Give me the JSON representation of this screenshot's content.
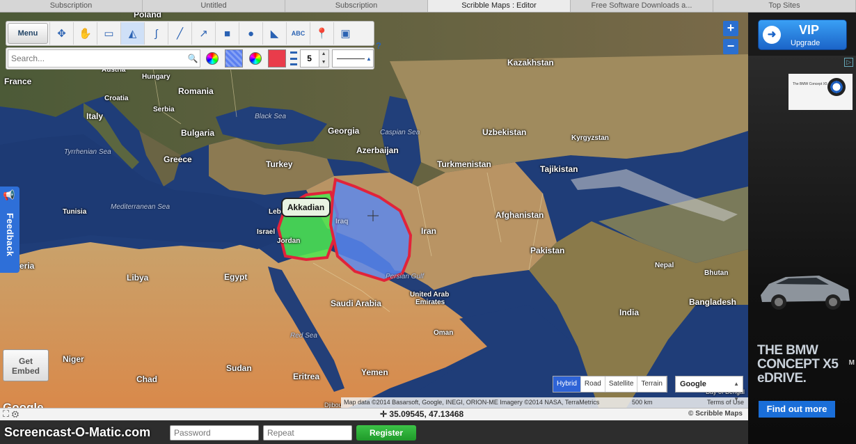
{
  "browser_tabs": [
    {
      "label": "Subscription",
      "active": false
    },
    {
      "label": "Untitled",
      "active": false
    },
    {
      "label": "Subscription",
      "active": false
    },
    {
      "label": "Scribble Maps : Editor",
      "active": true
    },
    {
      "label": "Free Software Downloads a...",
      "active": false
    },
    {
      "label": "Top Sites",
      "active": false
    }
  ],
  "toolbar": {
    "menu_label": "Menu",
    "text_tool_label": "ABC",
    "help_label": "?",
    "tools": [
      "pointer-icon",
      "hand-icon",
      "eraser-icon",
      "fill-icon",
      "freehand-icon",
      "line-icon",
      "arrow-icon",
      "rectangle-icon",
      "circle-icon",
      "polygon-icon",
      "text-icon",
      "marker-icon",
      "image-icon"
    ]
  },
  "search": {
    "placeholder": "Search..."
  },
  "style": {
    "line_width": "5",
    "fill_color": "#5b7ff0",
    "line_color": "#e93c4b"
  },
  "zoom": {
    "in_label": "+",
    "out_label": "−"
  },
  "feedback_label": "Feedback",
  "embed_label_1": "Get",
  "embed_label_2": "Embed",
  "popup_label": "Akkadian",
  "map_labels": {
    "poland": "Poland",
    "france": "France",
    "hungary": "Hungary",
    "romania": "Romania",
    "croatia": "Croatia",
    "serbia": "Serbia",
    "italy": "Italy",
    "bulgaria": "Bulgaria",
    "greece": "Greece",
    "turkey": "Turkey",
    "georgia": "Georgia",
    "azerbaijan": "Azerbaijan",
    "kazakhstan": "Kazakhstan",
    "uzbekistan": "Uzbekistan",
    "kyrgyzstan": "Kyrgyzstan",
    "turkmenistan": "Turkmenistan",
    "tajikistan": "Tajikistan",
    "afghanistan": "Afghanistan",
    "pakistan": "Pakistan",
    "iran": "Iran",
    "iraq": "Iraq",
    "tunisia": "Tunisia",
    "libya": "Libya",
    "egypt": "Egypt",
    "israel": "Israel",
    "jordan": "Jordan",
    "lebanon": "Leb",
    "saudi_arabia": "Saudi Arabia",
    "uae_1": "United Arab",
    "uae_2": "Emirates",
    "oman": "Oman",
    "yemen": "Yemen",
    "eritrea": "Eritrea",
    "sudan": "Sudan",
    "chad": "Chad",
    "niger": "Niger",
    "algeria": "eria",
    "india": "India",
    "nepal": "Nepal",
    "bhutan": "Bhutan",
    "bangladesh": "Bangladesh",
    "black_sea": "Black Sea",
    "caspian_sea": "Caspian Sea",
    "tyrrhenian_sea": "Tyrrhenian Sea",
    "mediterranean_sea": "Mediterranean Sea",
    "red_sea": "Red Sea",
    "persian_gulf": "Persian Gulf",
    "austria": "Austria",
    "bay_of_bengal": "Bay of Bengal",
    "djibouti": "Djibou"
  },
  "map_type": {
    "hybrid": "Hybrid",
    "road": "Road",
    "satellite": "Satellite",
    "terrain": "Terrain",
    "active": "Hybrid"
  },
  "provider": "Google",
  "google_logo": "Google",
  "attribution": "Map data ©2014 Basarsoft, Google, INEGI, ORION-ME Imagery ©2014 NASA, TerraMetrics",
  "scale_label": "500 km",
  "terms_label": "Terms of Use",
  "coordinates": "35.09545, 47.13468",
  "credit": "© Scribble Maps",
  "bottom": {
    "watermark": "Screencast-O-Matic.com",
    "password_placeholder": "Password",
    "repeat_placeholder": "Repeat",
    "register_label": "Register"
  },
  "vip": {
    "title": "VIP",
    "subtitle": "Upgrade"
  },
  "ad": {
    "line1": "THE BMW",
    "line2": "CONCEPT X5",
    "line3": "eDRIVE.",
    "cta": "Find out more",
    "badge": "▷",
    "card_text": "The BMW Concept X5 eDrive",
    "edge_letter": "M"
  }
}
